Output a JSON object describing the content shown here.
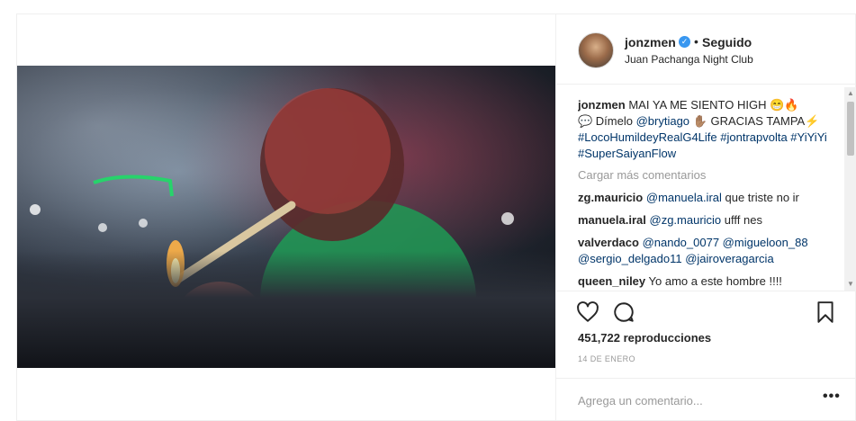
{
  "post": {
    "username": "jonzmen",
    "follow_status": "Seguido",
    "separator": "•",
    "location": "Juan Pachanga Night Club",
    "caption": {
      "user": "jonzmen",
      "text_1": " MAI YA ME SIENTO HIGH 😁🔥",
      "text_2": "💬 Dímelo ",
      "mention": "@brytiago",
      "text_3": " ✋🏽 GRACIAS TAMPA⚡ ",
      "hashtags": "#LocoHumildeyRealG4Life #jontrapvolta #YiYiYi #SuperSaiyanFlow"
    },
    "load_more": "Cargar más comentarios",
    "comments": [
      {
        "user": "zg.mauricio",
        "mention": "@manuela.iral",
        "text": " que triste no ir"
      },
      {
        "user": "manuela.iral",
        "mention": "@zg.mauricio",
        "text": " ufff nes"
      },
      {
        "user": "valverdaco",
        "mention": "@nando_0077 @migueloon_88 @sergio_delgado11 @jairoveragarcia",
        "text": ""
      },
      {
        "user": "queen_niley",
        "mention": "",
        "text": "Yo amo a este hombre !!!!"
      }
    ],
    "views": "451,722 reproducciones",
    "date": "14 DE ENERO",
    "comment_placeholder": "Agrega un comentario...",
    "more_label": "•••",
    "icons": {
      "verified": "verified-badge-icon",
      "like": "heart-icon",
      "comment": "comment-bubble-icon",
      "save": "bookmark-icon"
    }
  }
}
